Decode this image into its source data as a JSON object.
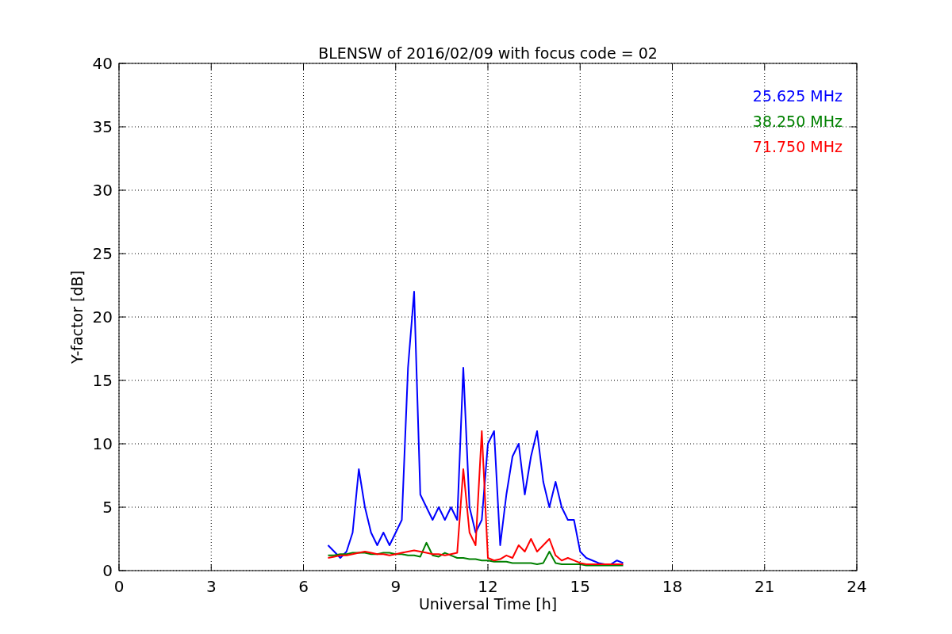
{
  "chart_data": {
    "type": "line",
    "title": "BLENSW of 2016/02/09 with focus code = 02",
    "xlabel": "Universal Time [h]",
    "ylabel": "Y-factor [dB]",
    "x": [
      6.8,
      7.0,
      7.2,
      7.4,
      7.6,
      7.8,
      8.0,
      8.2,
      8.4,
      8.6,
      8.8,
      9.0,
      9.2,
      9.4,
      9.6,
      9.8,
      10.0,
      10.2,
      10.4,
      10.6,
      10.8,
      11.0,
      11.2,
      11.4,
      11.6,
      11.8,
      12.0,
      12.2,
      12.4,
      12.6,
      12.8,
      13.0,
      13.2,
      13.4,
      13.6,
      13.8,
      14.0,
      14.2,
      14.4,
      14.6,
      14.8,
      15.0,
      15.2,
      15.4,
      15.6,
      15.8,
      16.0,
      16.2,
      16.4
    ],
    "series": [
      {
        "name": "25.625 MHz",
        "color": "#0000ff",
        "values": [
          2,
          1.5,
          1,
          1.5,
          3,
          8,
          5,
          3,
          2,
          3,
          2,
          3,
          4,
          16,
          22,
          6,
          5,
          4,
          5,
          4,
          5,
          4,
          16,
          5,
          3,
          4,
          10,
          11,
          2,
          6,
          9,
          10,
          6,
          9,
          11,
          7,
          5,
          7,
          5,
          4,
          4,
          1.5,
          1,
          0.8,
          0.6,
          0.5,
          0.5,
          0.8,
          0.6
        ]
      },
      {
        "name": "38.250 MHz",
        "color": "#008000",
        "values": [
          1.2,
          1.2,
          1.3,
          1.3,
          1.4,
          1.4,
          1.4,
          1.3,
          1.3,
          1.4,
          1.4,
          1.3,
          1.3,
          1.2,
          1.2,
          1.1,
          2.2,
          1.2,
          1.1,
          1.4,
          1.2,
          1.0,
          1.0,
          0.9,
          0.9,
          0.8,
          0.8,
          0.7,
          0.7,
          0.7,
          0.6,
          0.6,
          0.6,
          0.6,
          0.5,
          0.6,
          1.5,
          0.6,
          0.5,
          0.5,
          0.5,
          0.5,
          0.4,
          0.4,
          0.4,
          0.4,
          0.4,
          0.4,
          0.4
        ]
      },
      {
        "name": "71.750 MHz",
        "color": "#ff0000",
        "values": [
          1.0,
          1.1,
          1.2,
          1.2,
          1.3,
          1.4,
          1.5,
          1.4,
          1.3,
          1.3,
          1.2,
          1.3,
          1.4,
          1.5,
          1.6,
          1.5,
          1.4,
          1.3,
          1.3,
          1.2,
          1.3,
          1.4,
          8,
          3,
          2,
          11,
          1,
          0.8,
          0.9,
          1.2,
          1.0,
          2,
          1.5,
          2.5,
          1.5,
          2,
          2.5,
          1.2,
          0.8,
          1.0,
          0.8,
          0.6,
          0.5,
          0.5,
          0.5,
          0.5,
          0.5,
          0.5,
          0.5
        ]
      }
    ],
    "grid": true,
    "xlim": [
      0,
      24
    ],
    "ylim": [
      0,
      40
    ],
    "xticks": [
      0,
      3,
      6,
      9,
      12,
      15,
      18,
      21,
      24
    ],
    "yticks": [
      0,
      5,
      10,
      15,
      20,
      25,
      30,
      35,
      40
    ]
  }
}
